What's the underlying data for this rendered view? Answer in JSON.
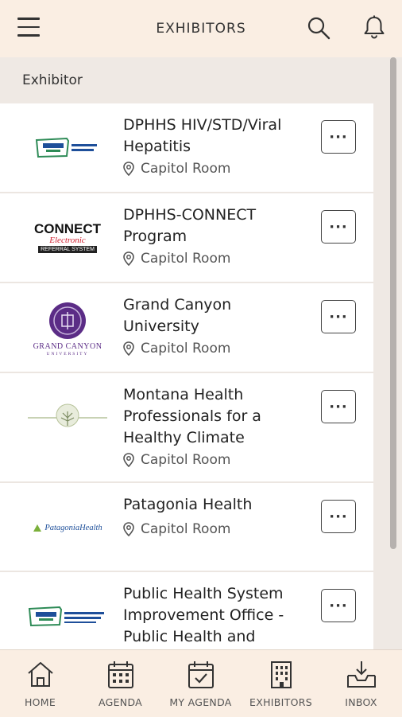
{
  "header": {
    "title": "EXHIBITORS",
    "menu_icon": "hamburger-menu-icon",
    "search_icon": "search-icon",
    "notification_icon": "bell-icon"
  },
  "section": {
    "label": "Exhibitor"
  },
  "exhibitors": [
    {
      "name": "DPHHS HIV/STD/Viral Hepatitis",
      "location": "Capitol Room",
      "logo": "dphhs-montana-logo",
      "more_label": "···"
    },
    {
      "name": "DPHHS-CONNECT Program",
      "location": "Capitol Room",
      "logo": "connect-electronic-referral-logo",
      "logo_text": "CONNECT",
      "logo_sub": "Electronic",
      "logo_sub2": "REFERRAL SYSTEM",
      "more_label": "···"
    },
    {
      "name": "Grand Canyon University",
      "location": "Capitol Room",
      "logo": "grand-canyon-university-logo",
      "logo_text": "GRAND CANYON",
      "logo_sub": "UNIVERSITY",
      "more_label": "···"
    },
    {
      "name": "Montana Health Professionals for a Healthy Climate",
      "location": "Capitol Room",
      "logo": "tree-logo",
      "more_label": "···"
    },
    {
      "name": "Patagonia Health",
      "location": "Capitol Room",
      "logo": "patagonia-health-logo",
      "logo_text": "PatagoniaHealth",
      "more_label": "···"
    },
    {
      "name": "Public Health System Improvement Office - Public Health and",
      "location": "",
      "logo": "dphhs-montana-logo",
      "more_label": "···"
    }
  ],
  "bottom_nav": [
    {
      "label": "HOME",
      "icon": "home-icon"
    },
    {
      "label": "AGENDA",
      "icon": "calendar-icon"
    },
    {
      "label": "MY AGENDA",
      "icon": "calendar-check-icon"
    },
    {
      "label": "EXHIBITORS",
      "icon": "building-icon"
    },
    {
      "label": "INBOX",
      "icon": "inbox-download-icon"
    }
  ],
  "colors": {
    "header_bg": "#faeee3",
    "content_bg": "#efe9e4",
    "card_bg": "#ffffff",
    "scroll_thumb": "#b6b1ae"
  }
}
